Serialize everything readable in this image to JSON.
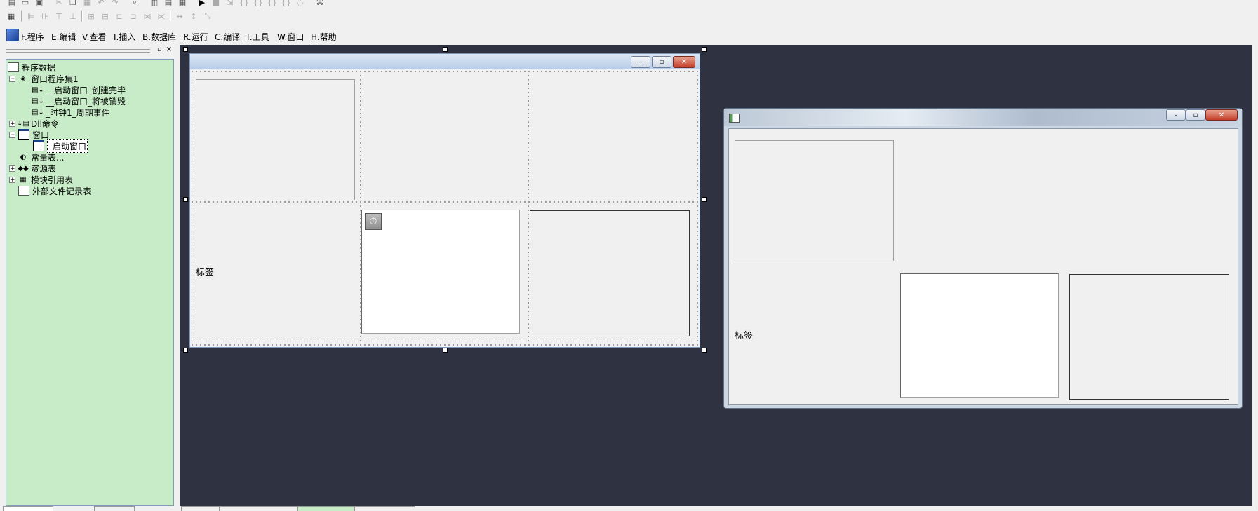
{
  "menubar": {
    "items": [
      {
        "key": "F",
        "label": ".程序"
      },
      {
        "key": "E",
        "label": ".编辑"
      },
      {
        "key": "V",
        "label": ".查看"
      },
      {
        "key": "I",
        "label": ".插入"
      },
      {
        "key": "B",
        "label": ".数据库"
      },
      {
        "key": "R",
        "label": ".运行"
      },
      {
        "key": "C",
        "label": ".编译"
      },
      {
        "key": "T",
        "label": ".工具"
      },
      {
        "key": "W",
        "label": ".窗口"
      },
      {
        "key": "H",
        "label": ".帮助"
      }
    ]
  },
  "tree": {
    "root_label": "程序数据",
    "items": [
      {
        "label": "窗口程序集1"
      },
      {
        "label": "__启动窗口_创建完毕"
      },
      {
        "label": "__启动窗口_将被销毁"
      },
      {
        "label": "_时钟1_周期事件"
      },
      {
        "label": "Dll命令"
      },
      {
        "label": "窗口"
      },
      {
        "label": "_启动窗口"
      },
      {
        "label": "常量表..."
      },
      {
        "label": "资源表"
      },
      {
        "label": "模块引用表"
      },
      {
        "label": "外部文件记录表"
      }
    ]
  },
  "design_form": {
    "label_text": "标签"
  },
  "run_window": {
    "label_text": "标签"
  },
  "colors": {
    "tree_bg": "#c7ecc7",
    "design_bg": "#2e3241"
  }
}
